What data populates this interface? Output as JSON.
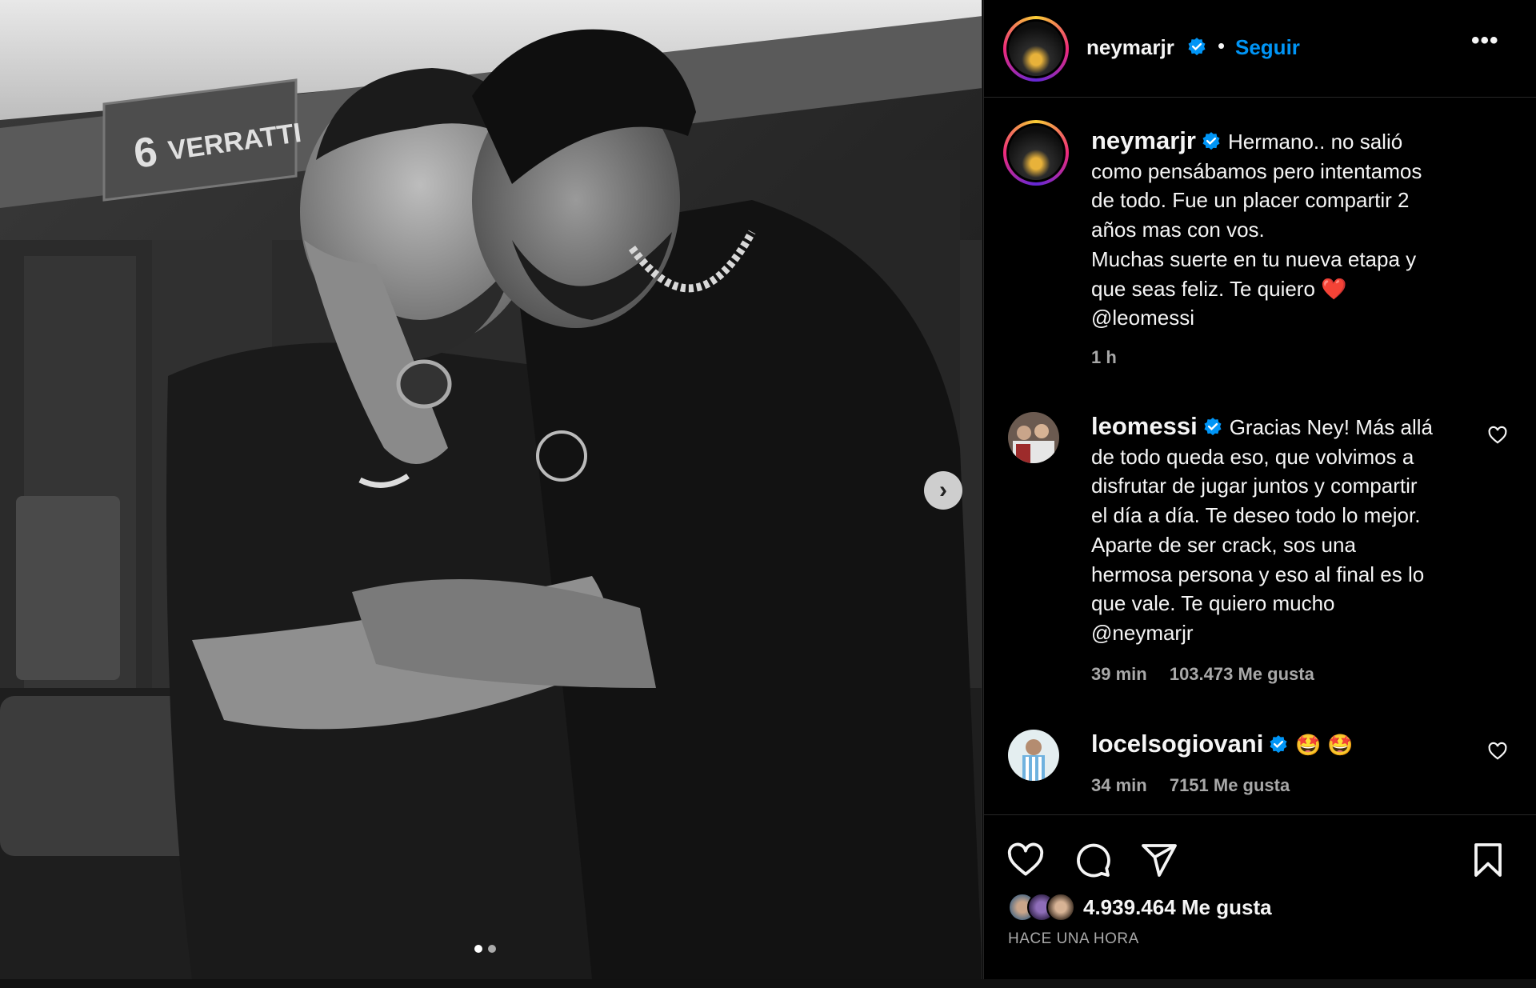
{
  "post": {
    "username": "neymarjr",
    "follow_label": "Seguir",
    "separator": "•",
    "more_label": "•••",
    "caption": {
      "username": "neymarjr",
      "text": "Hermano.. no salió\ncomo pensábamos pero intentamos\nde todo. Fue un placer compartir 2\naños mas con vos.\nMuchas suerte en tu nueva etapa y\nque seas feliz. Te quiero ❤️\n@leomessi",
      "time": "1 h"
    },
    "comments": [
      {
        "username": "leomessi",
        "text": "Gracias Ney! Más allá\nde todo queda eso, que volvimos a\ndisfrutar de jugar juntos y compartir\nel día a día. Te deseo todo lo mejor.\nAparte de ser crack, sos una\nhermosa persona y eso al final es lo\nque vale. Te quiero mucho\n@neymarjr",
        "time": "39 min",
        "likes": "103.473 Me gusta"
      },
      {
        "username": "locelsogiovani",
        "text": "🤩 🤩",
        "time": "34 min",
        "likes": "7151 Me gusta"
      }
    ],
    "likes_total": "4.939.464 Me gusta",
    "timestamp": "HACE UNA HORA",
    "carousel": {
      "count": 2,
      "active": 0,
      "next_label": "›"
    }
  },
  "colors": {
    "follow": "#0095f6",
    "verified": "#0095f6",
    "heart": "#ed4956",
    "muted": "#a8a8a8"
  },
  "icons": [
    "verified-badge-icon",
    "more-icon",
    "heart-icon",
    "comment-icon",
    "share-icon",
    "bookmark-icon",
    "chevron-right-icon"
  ]
}
